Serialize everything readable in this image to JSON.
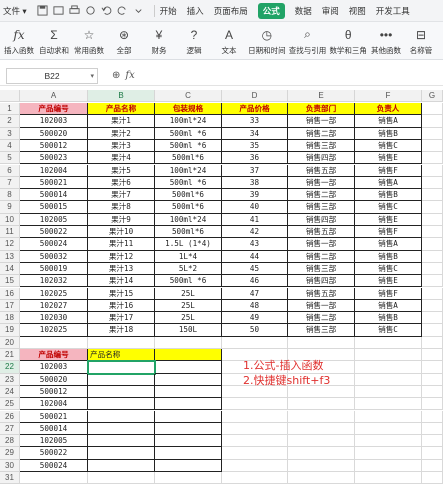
{
  "menu": {
    "file": "文件",
    "tabs": [
      "开始",
      "插入",
      "页面布局",
      "公式",
      "数据",
      "审阅",
      "视图",
      "开发工具"
    ],
    "active_tab": "公式"
  },
  "ribbon": {
    "buttons": [
      {
        "label": "插入函数",
        "icon": "fx-icon"
      },
      {
        "label": "自动求和",
        "icon": "sigma-icon"
      },
      {
        "label": "常用函数",
        "icon": "star-icon"
      },
      {
        "label": "全部",
        "icon": "asterisk-icon"
      },
      {
        "label": "财务",
        "icon": "yen-icon"
      },
      {
        "label": "逻辑",
        "icon": "question-icon"
      },
      {
        "label": "文本",
        "icon": "text-a-icon"
      },
      {
        "label": "日期和时间",
        "icon": "clock-icon"
      },
      {
        "label": "查找与引用",
        "icon": "search-icon"
      },
      {
        "label": "数学和三角",
        "icon": "theta-icon"
      },
      {
        "label": "其他函数",
        "icon": "more-icon"
      },
      {
        "label": "名称管",
        "icon": "tag-icon"
      }
    ]
  },
  "formula_bar": {
    "name_box": "B22",
    "fx": "fx"
  },
  "columns": [
    "A",
    "B",
    "C",
    "D",
    "E",
    "F",
    "G"
  ],
  "selected_column": "B",
  "selected_row": "22",
  "table1": {
    "headers": [
      "产品编号",
      "产品名称",
      "包装规格",
      "产品价格",
      "负责部门",
      "负责人"
    ],
    "rows": [
      [
        "102003",
        "果汁1",
        "100ml*24",
        "33",
        "销售一部",
        "销售A"
      ],
      [
        "500020",
        "果汁2",
        "500ml *6",
        "34",
        "销售二部",
        "销售B"
      ],
      [
        "500012",
        "果汁3",
        "500ml *6",
        "35",
        "销售三部",
        "销售C"
      ],
      [
        "500023",
        "果汁4",
        "500ml*6",
        "36",
        "销售四部",
        "销售E"
      ],
      [
        "102004",
        "果汁5",
        "100ml*24",
        "37",
        "销售五部",
        "销售F"
      ],
      [
        "500021",
        "果汁6",
        "500ml *6",
        "38",
        "销售一部",
        "销售A"
      ],
      [
        "500014",
        "果汁7",
        "500ml*6",
        "39",
        "销售二部",
        "销售B"
      ],
      [
        "500015",
        "果汁8",
        "500ml*6",
        "40",
        "销售三部",
        "销售C"
      ],
      [
        "102005",
        "果汁9",
        "100ml*24",
        "41",
        "销售四部",
        "销售E"
      ],
      [
        "500022",
        "果汁10",
        "500ml*6",
        "42",
        "销售五部",
        "销售F"
      ],
      [
        "500024",
        "果汁11",
        "1.5L (1*4)",
        "43",
        "销售一部",
        "销售A"
      ],
      [
        "500032",
        "果汁12",
        "1L*4",
        "44",
        "销售二部",
        "销售B"
      ],
      [
        "500019",
        "果汁13",
        "5L*2",
        "45",
        "销售三部",
        "销售C"
      ],
      [
        "102032",
        "果汁14",
        "500ml *6",
        "46",
        "销售四部",
        "销售E"
      ],
      [
        "102025",
        "果汁15",
        "25L",
        "47",
        "销售五部",
        "销售F"
      ],
      [
        "102027",
        "果汁16",
        "25L",
        "48",
        "销售一部",
        "销售A"
      ],
      [
        "102030",
        "果汁17",
        "25L",
        "49",
        "销售二部",
        "销售B"
      ],
      [
        "102025",
        "果汁18",
        "150L",
        "50",
        "销售三部",
        "销售C"
      ]
    ]
  },
  "table2": {
    "headers": [
      "产品编号",
      "产品名称"
    ],
    "codes": [
      "102003",
      "500020",
      "500012",
      "102004",
      "500021",
      "500014",
      "102005",
      "500022",
      "500024"
    ]
  },
  "row_numbers": [
    "1",
    "2",
    "3",
    "4",
    "5",
    "6",
    "7",
    "8",
    "9",
    "10",
    "11",
    "12",
    "13",
    "14",
    "15",
    "16",
    "17",
    "18",
    "19",
    "20",
    "21",
    "22",
    "23",
    "24",
    "25",
    "26",
    "27",
    "28",
    "29",
    "30",
    "31"
  ],
  "note": {
    "line1": "1.公式-插入函数",
    "line2": "2.快捷键shift+f3"
  },
  "colors": {
    "accent": "#21a366",
    "header_pink": "#f5b5bf",
    "header_yellow": "#ffff00",
    "note_red": "#e0302e"
  }
}
